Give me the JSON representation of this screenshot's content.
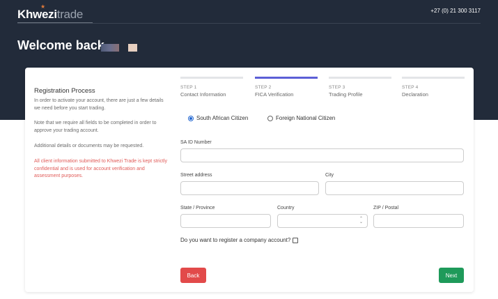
{
  "header": {
    "logo_main": "Khwezi",
    "logo_sub": "trade",
    "phone": "+27 (0) 21 300 3117",
    "welcome": "Welcome back,"
  },
  "sidebar": {
    "title": "Registration Process",
    "p1": "In order to activate your account, there are just a few details we need before you start trading.",
    "p2": "Note that we require all fields to be completed in order to approve your trading account.",
    "p3": "Additional details or documents may be requested.",
    "p4": "All client information submitted to Khwezi Trade is kept strictly confidential and is used for account verification and assessment purposes."
  },
  "steps": [
    {
      "num": "STEP 1",
      "name": "Contact Information",
      "active": false
    },
    {
      "num": "STEP 2",
      "name": "FICA Verification",
      "active": true
    },
    {
      "num": "STEP 3",
      "name": "Trading Profile",
      "active": false
    },
    {
      "num": "STEP 4",
      "name": "Declaration",
      "active": false
    }
  ],
  "citizenship": {
    "options": [
      "South African Citizen",
      "Foreign National Citizen"
    ],
    "selected": "South African Citizen"
  },
  "form": {
    "sa_id_label": "SA ID Number",
    "street_label": "Street address",
    "city_label": "City",
    "state_label": "State / Province",
    "country_label": "Country",
    "zip_label": "ZIP / Postal",
    "company_question": "Do you want to register a company account?",
    "company_checked": false
  },
  "buttons": {
    "back": "Back",
    "next": "Next"
  },
  "colors": {
    "header_bg": "#222b3a",
    "active_step": "#5c5fd6",
    "back_button": "#e24a4a",
    "next_button": "#1e9a5a",
    "notice_text": "#e05a57"
  }
}
